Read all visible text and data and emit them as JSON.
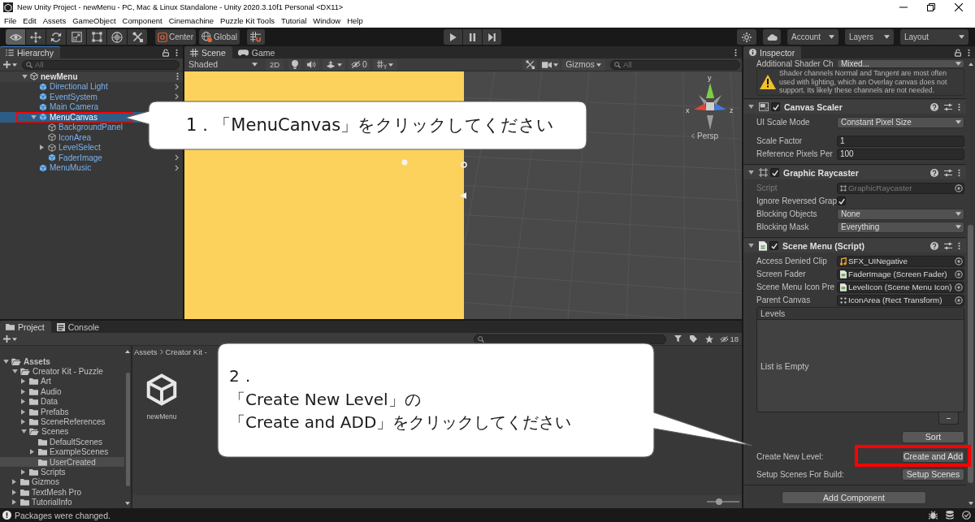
{
  "window": {
    "title": "New Unity Project - newMenu - PC, Mac & Linux Standalone - Unity 2020.3.10f1 Personal <DX11>"
  },
  "menu": [
    "File",
    "Edit",
    "Assets",
    "GameObject",
    "Component",
    "Cinemachine",
    "Puzzle Kit Tools",
    "Tutorial",
    "Window",
    "Help"
  ],
  "toolbar": {
    "tools": [
      {
        "kind": "view",
        "selected": true
      },
      {
        "kind": "move",
        "selected": false
      },
      {
        "kind": "rotate",
        "selected": false
      },
      {
        "kind": "scale",
        "selected": false
      },
      {
        "kind": "rect",
        "selected": false
      },
      {
        "kind": "transform",
        "selected": false
      },
      {
        "kind": "custom",
        "selected": false
      }
    ],
    "pivot": "Center",
    "space": "Global",
    "account": "Account",
    "layers": "Layers",
    "layout": "Layout"
  },
  "hierarchy": {
    "tab": "Hierarchy",
    "search": {
      "placeholder": "All"
    },
    "scene": {
      "name": "newMenu",
      "expanded": true,
      "children": [
        {
          "name": "Directional Light",
          "kind": "prefab",
          "selected": false,
          "highlighted": false,
          "open_arrow": true
        },
        {
          "name": "EventSystem",
          "kind": "prefab",
          "selected": false,
          "highlighted": false,
          "open_arrow": true
        },
        {
          "name": "Main Camera",
          "kind": "prefab",
          "selected": false,
          "highlighted": false,
          "open_arrow": false
        },
        {
          "name": "MenuCanvas",
          "kind": "prefab",
          "selected": true,
          "highlighted": true,
          "expanded": true,
          "open_arrow": false,
          "children": [
            {
              "name": "BackgroundPanel",
              "kind": "object",
              "selected": false,
              "highlighted": false,
              "open_arrow": false
            },
            {
              "name": "IconArea",
              "kind": "object",
              "selected": false,
              "highlighted": false,
              "open_arrow": false
            },
            {
              "name": "LevelSelect",
              "kind": "object",
              "selected": false,
              "highlighted": false,
              "expanded": false,
              "open_arrow": false
            },
            {
              "name": "FaderImage",
              "kind": "prefab",
              "selected": false,
              "highlighted": false,
              "open_arrow": true
            }
          ]
        },
        {
          "name": "MenuMusic",
          "kind": "prefab",
          "selected": false,
          "highlighted": false,
          "open_arrow": true
        }
      ]
    }
  },
  "scene_view": {
    "tabs": [
      {
        "label": "Scene",
        "kind": "scene",
        "selected": true
      },
      {
        "label": "Game",
        "kind": "game",
        "selected": false
      }
    ],
    "shading": "Shaded",
    "mode_2d": "2D",
    "hidden_count": "0",
    "gizmos": "Gizmos",
    "search": {
      "placeholder": "All"
    },
    "axes": [
      "y",
      "x",
      "z"
    ],
    "projection": "Persp"
  },
  "project": {
    "tabs": [
      {
        "label": "Project",
        "kind": "project",
        "selected": true
      },
      {
        "label": "Console",
        "kind": "console",
        "selected": false
      }
    ],
    "hidden_count": "18",
    "tree": [
      {
        "name": "Assets",
        "expanded": true,
        "selected": false,
        "children": [
          {
            "name": "Creator Kit - Puzzle",
            "expanded": true,
            "selected": false,
            "children": [
              {
                "name": "Art",
                "expanded": false,
                "selected": false
              },
              {
                "name": "Audio",
                "expanded": false,
                "selected": false
              },
              {
                "name": "Data",
                "expanded": false,
                "selected": false
              },
              {
                "name": "Prefabs",
                "expanded": false,
                "selected": false
              },
              {
                "name": "SceneReferences",
                "expanded": false,
                "selected": false
              },
              {
                "name": "Scenes",
                "expanded": true,
                "selected": false,
                "children": [
                  {
                    "name": "DefaultScenes",
                    "selected": false
                  },
                  {
                    "name": "ExampleScenes",
                    "expanded": false,
                    "selected": false
                  },
                  {
                    "name": "UserCreated",
                    "selected": true
                  }
                ]
              },
              {
                "name": "Scripts",
                "expanded": false,
                "selected": false
              }
            ]
          },
          {
            "name": "Gizmos",
            "expanded": false,
            "selected": false
          },
          {
            "name": "TextMesh Pro",
            "expanded": false,
            "selected": false
          },
          {
            "name": "TutorialInfo",
            "expanded": false,
            "selected": false
          }
        ]
      }
    ],
    "breadcrumb": [
      "Assets",
      "Creator Kit -"
    ],
    "assets": [
      {
        "name": "newMenu",
        "kind": "scene"
      }
    ],
    "icon_size": {
      "level": 0.35
    }
  },
  "inspector": {
    "tab": "Inspector",
    "top_row": {
      "kind": "dropdown",
      "label": "Additional Shader Ch",
      "value": "Mixed...",
      "disabled": false,
      "highlighted": false
    },
    "warning": "Shader channels Normal and Tangent are most often used with lighting, which an Overlay canvas does not support. Its likely these channels are not needed.",
    "components": [
      {
        "title": "Canvas Scaler",
        "kind": "scaler",
        "enabled": true,
        "expanded": true,
        "rows": [
          {
            "kind": "dropdown",
            "label": "UI Scale Mode",
            "value": "Constant Pixel Size",
            "disabled": false,
            "highlighted": false
          },
          {
            "kind": "text",
            "label": "Scale Factor",
            "value": "1",
            "disabled": false,
            "highlighted": false
          },
          {
            "kind": "text",
            "label": "Reference Pixels Per",
            "value": "100",
            "disabled": false,
            "highlighted": false
          }
        ]
      },
      {
        "title": "Graphic Raycaster",
        "kind": "raycaster",
        "enabled": true,
        "expanded": true,
        "rows": [
          {
            "kind": "script",
            "label": "Script",
            "value": "GraphicRaycaster",
            "disabled": true,
            "highlighted": false
          },
          {
            "kind": "checkbox",
            "label": "Ignore Reversed Grap",
            "checked": true,
            "disabled": false,
            "highlighted": false
          },
          {
            "kind": "dropdown",
            "label": "Blocking Objects",
            "value": "None",
            "disabled": false,
            "highlighted": false
          },
          {
            "kind": "dropdown",
            "label": "Blocking Mask",
            "value": "Everything",
            "disabled": false,
            "highlighted": false
          }
        ]
      },
      {
        "title": "Scene Menu (Script)",
        "kind": "script",
        "enabled": true,
        "expanded": true,
        "rows": [
          {
            "kind": "audio",
            "label": "Access Denied Clip",
            "value": "SFX_UINegative",
            "disabled": false,
            "highlighted": false
          },
          {
            "kind": "component",
            "label": "Screen Fader",
            "value": "FaderImage (Screen Fader)",
            "disabled": false,
            "highlighted": false
          },
          {
            "kind": "component",
            "label": "Scene Menu Icon Pre",
            "value": "LevelIcon (Scene Menu Icon)",
            "disabled": false,
            "highlighted": false
          },
          {
            "kind": "transform",
            "label": "Parent Canvas",
            "value": "IconArea (Rect Transform)",
            "disabled": false,
            "highlighted": false
          },
          {
            "kind": "list",
            "label": "Levels",
            "value": "List is Empty",
            "disabled": false,
            "highlighted": false
          },
          {
            "kind": "button",
            "value": "Sort",
            "disabled": false,
            "highlighted": false
          },
          {
            "kind": "action",
            "label": "Create New Level:",
            "value": "Create and Add",
            "disabled": false,
            "highlighted": true
          },
          {
            "kind": "action",
            "label": "Setup Scenes For Build:",
            "value": "Setup Scenes",
            "disabled": false,
            "highlighted": false
          }
        ]
      }
    ],
    "add_component": "Add Component"
  },
  "status_bar": {
    "message": "Packages were changed."
  },
  "callouts": [
    {
      "kind": "left_pointer",
      "lines": [
        "1．「MenuCanvas」をクリックしてください"
      ]
    },
    {
      "kind": "right_pointer",
      "lines": [
        "2．",
        "「Create New Level」の",
        "「Create and ADD」をクリックしてください"
      ]
    }
  ]
}
